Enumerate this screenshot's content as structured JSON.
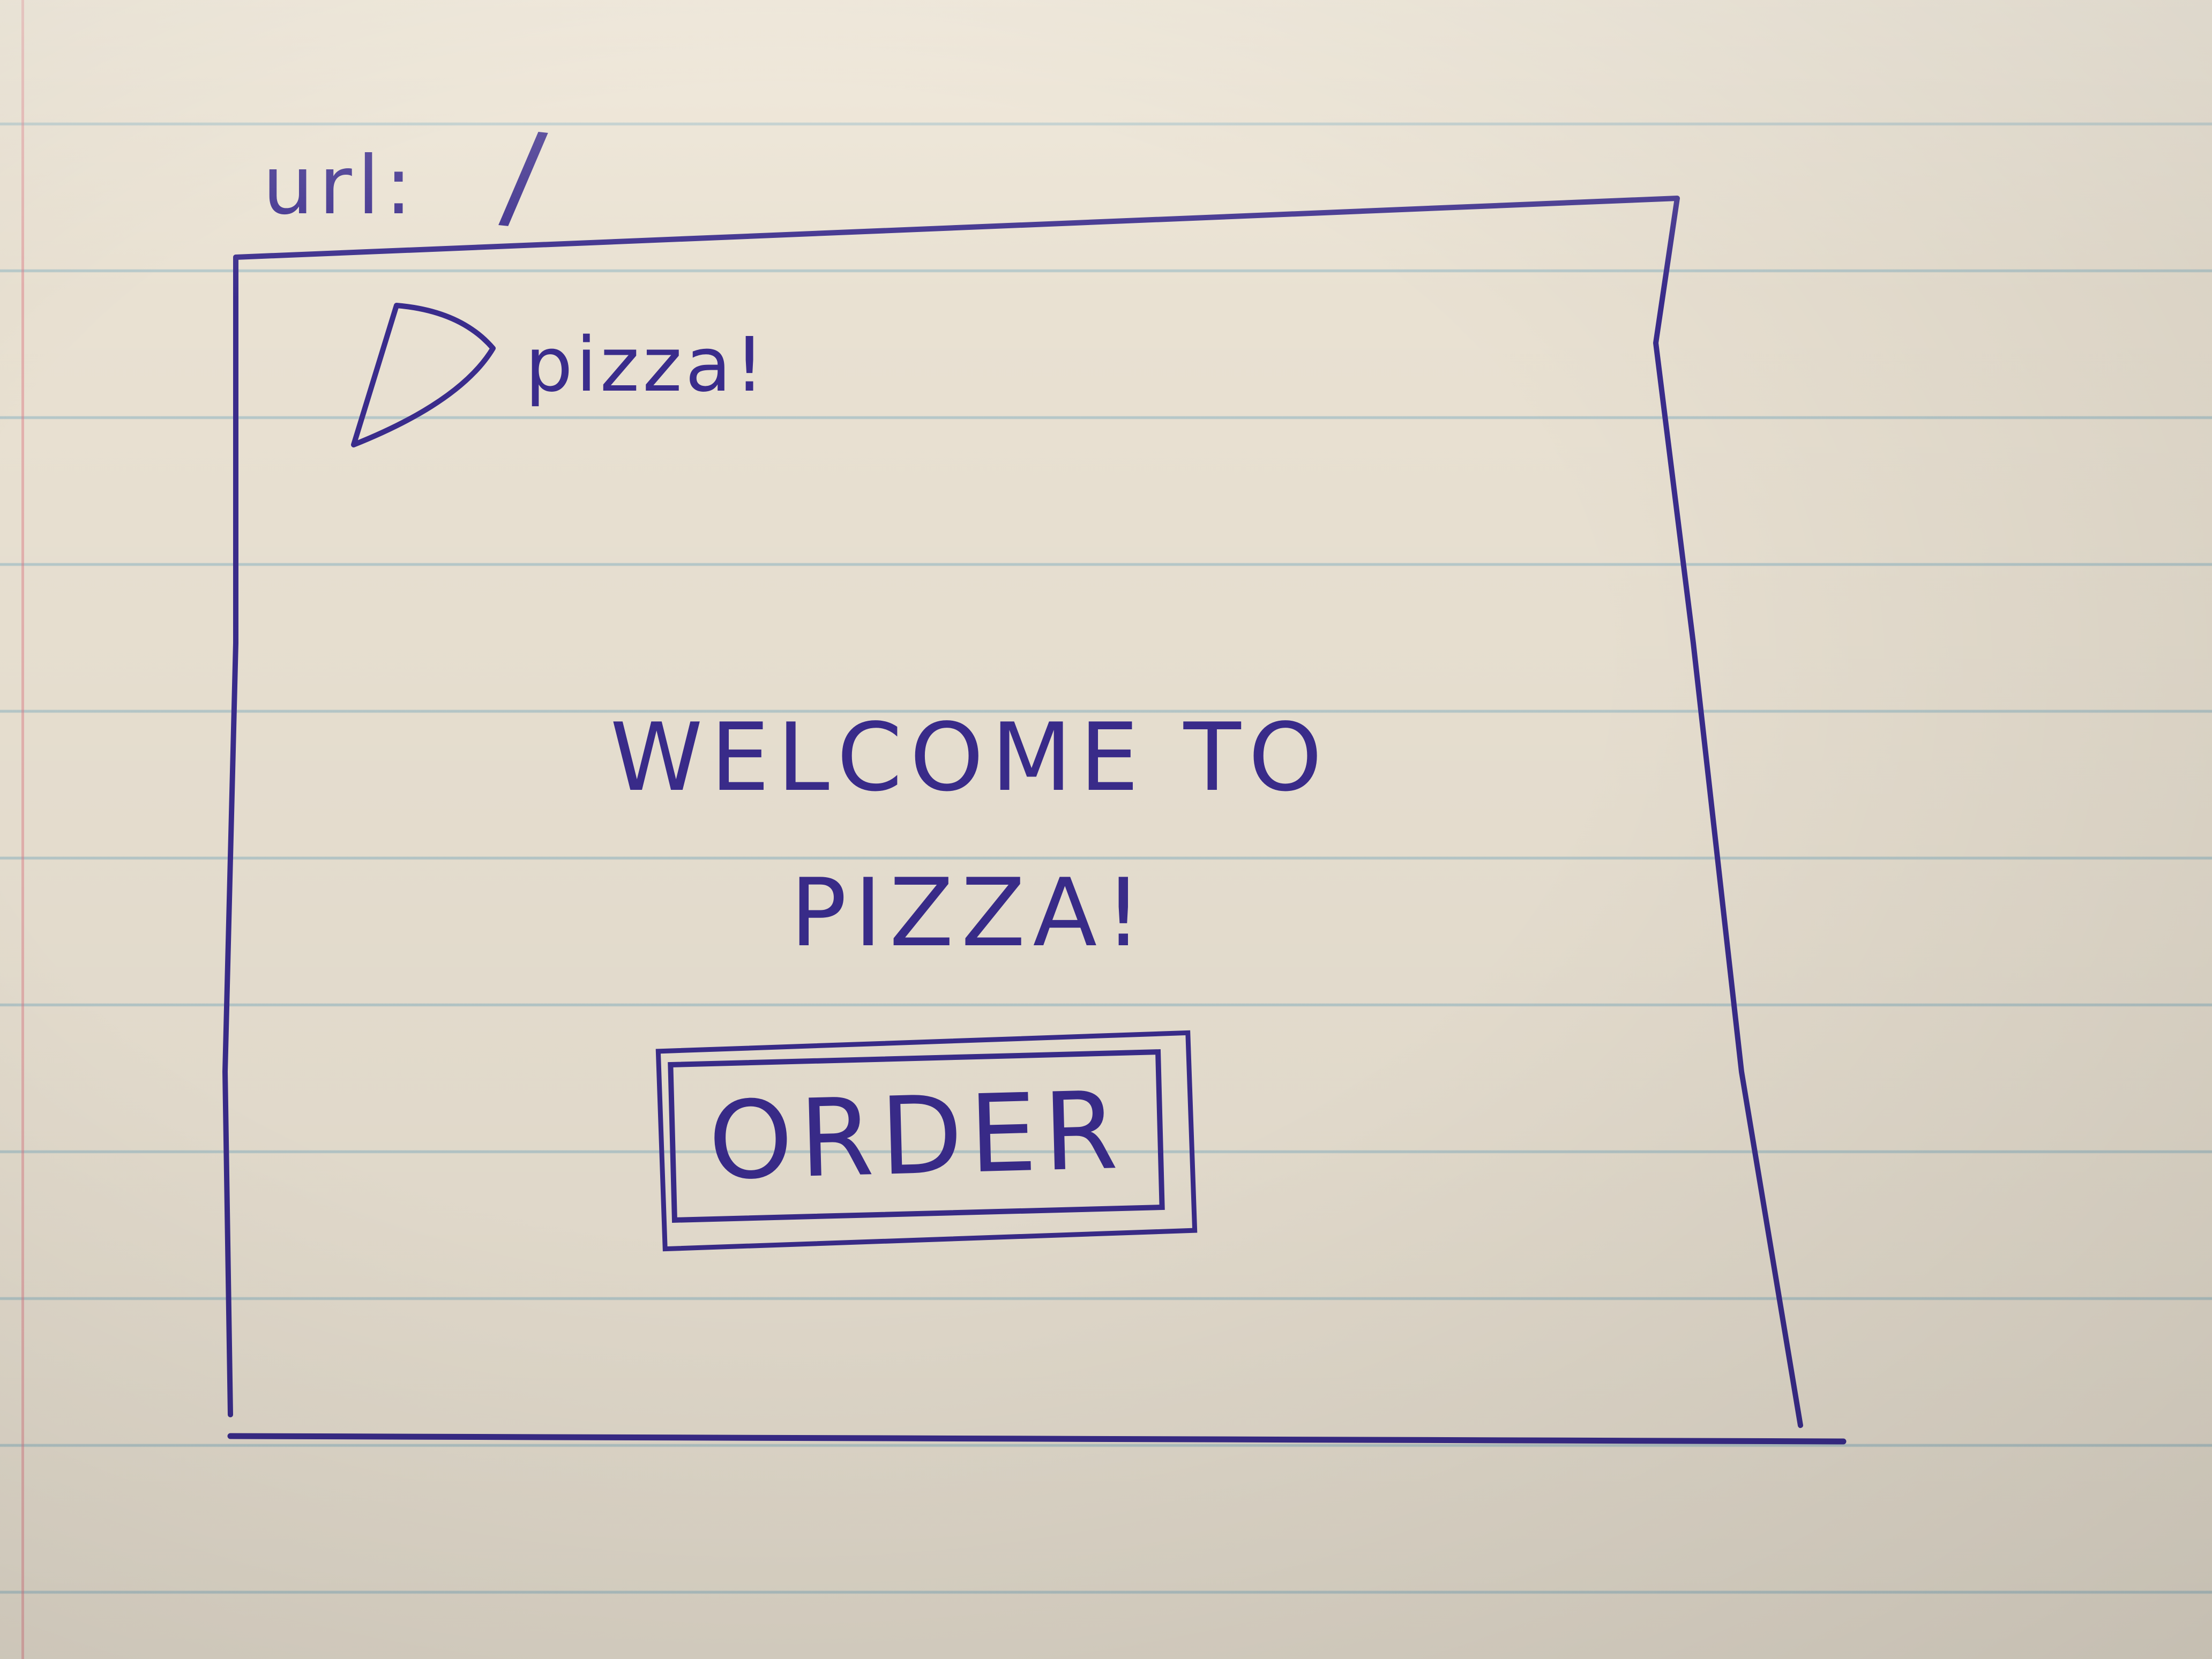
{
  "url_bar": {
    "label": "url:",
    "value": "/"
  },
  "header": {
    "logo_icon": "pizza-slice-icon",
    "logo_text": "pizza!"
  },
  "main": {
    "headline_line1": "WELCOME TO",
    "headline_line2": "PIZZA!",
    "order_button_label": "ORDER"
  },
  "colors": {
    "ink": "#3a2c8c",
    "paper": "#e9e1d2",
    "ruled_line": "#78aabe"
  }
}
